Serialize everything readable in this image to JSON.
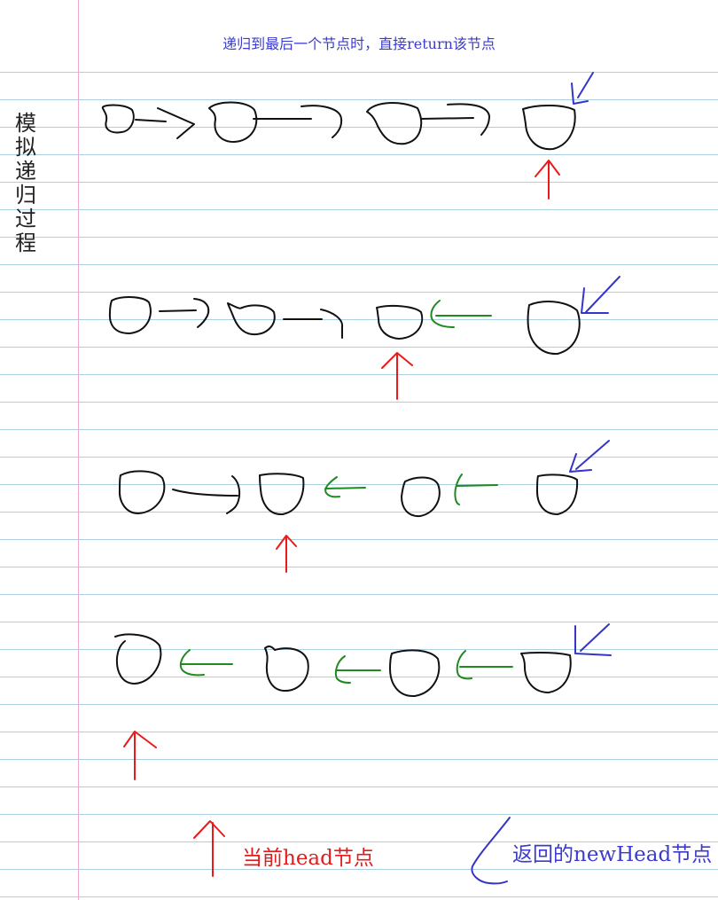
{
  "caption": "递归到最后一个节点时，直接return该节点",
  "side_title": "模拟递归过程",
  "legend": {
    "current_head": "当前head节点",
    "returned_new_head": "返回的newHead节点"
  },
  "colors": {
    "paper_rule": "#a9cfe0",
    "margin_line": "#f2a6d6",
    "node_stroke": "#111111",
    "current_head_arrow": "#ea1a1a",
    "reversed_link": "#1f8a1f",
    "new_head_marker": "#3535c8",
    "caption_text": "#3b3bcc"
  },
  "steps": [
    {
      "nodes": 4,
      "links": [
        "forward",
        "forward",
        "forward"
      ],
      "current_head_node": 4,
      "new_head_node": 4
    },
    {
      "nodes": 4,
      "links": [
        "forward",
        "forward",
        "backward"
      ],
      "current_head_node": 3,
      "new_head_node": 4
    },
    {
      "nodes": 4,
      "links": [
        "forward",
        "backward",
        "backward"
      ],
      "current_head_node": 2,
      "new_head_node": 4
    },
    {
      "nodes": 4,
      "links": [
        "backward",
        "backward",
        "backward"
      ],
      "current_head_node": 1,
      "new_head_node": 4
    }
  ]
}
